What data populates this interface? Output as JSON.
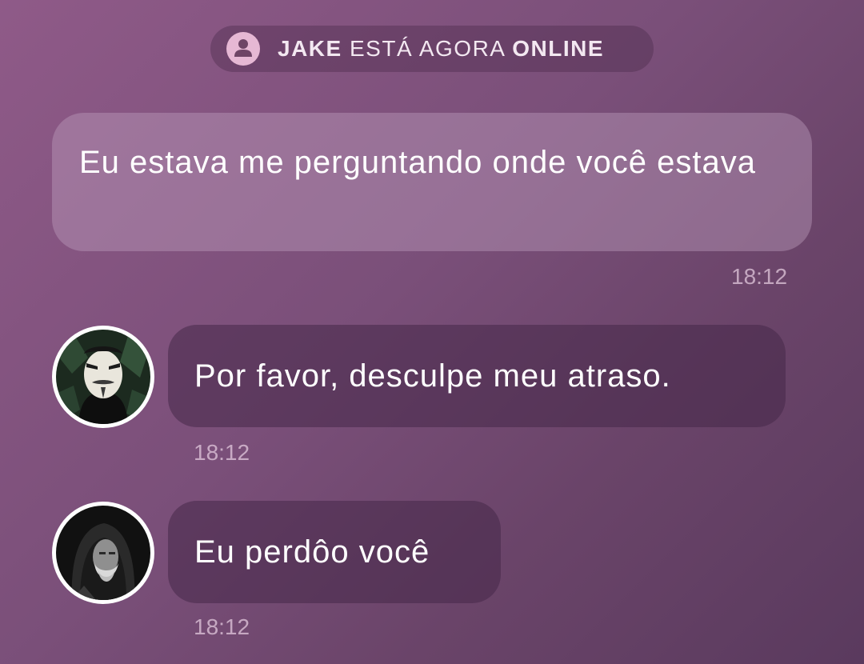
{
  "status": {
    "name": "JAKE",
    "middle": "ESTÁ AGORA",
    "state": "ONLINE",
    "icon": "user-icon"
  },
  "messages": [
    {
      "direction": "received",
      "text": "Eu estava me perguntando onde você estava",
      "time": "18:12"
    },
    {
      "direction": "sent",
      "avatar": "masked-person-avatar",
      "text": "Por favor, desculpe meu atraso.",
      "time": "18:12"
    },
    {
      "direction": "sent",
      "avatar": "hooded-bearded-man-avatar",
      "text": "Eu perdôo você",
      "time": "18:12"
    }
  ],
  "colors": {
    "background_start": "#8f5a88",
    "background_end": "#5a3a5e",
    "status_icon_bg": "#e6b8d4"
  }
}
